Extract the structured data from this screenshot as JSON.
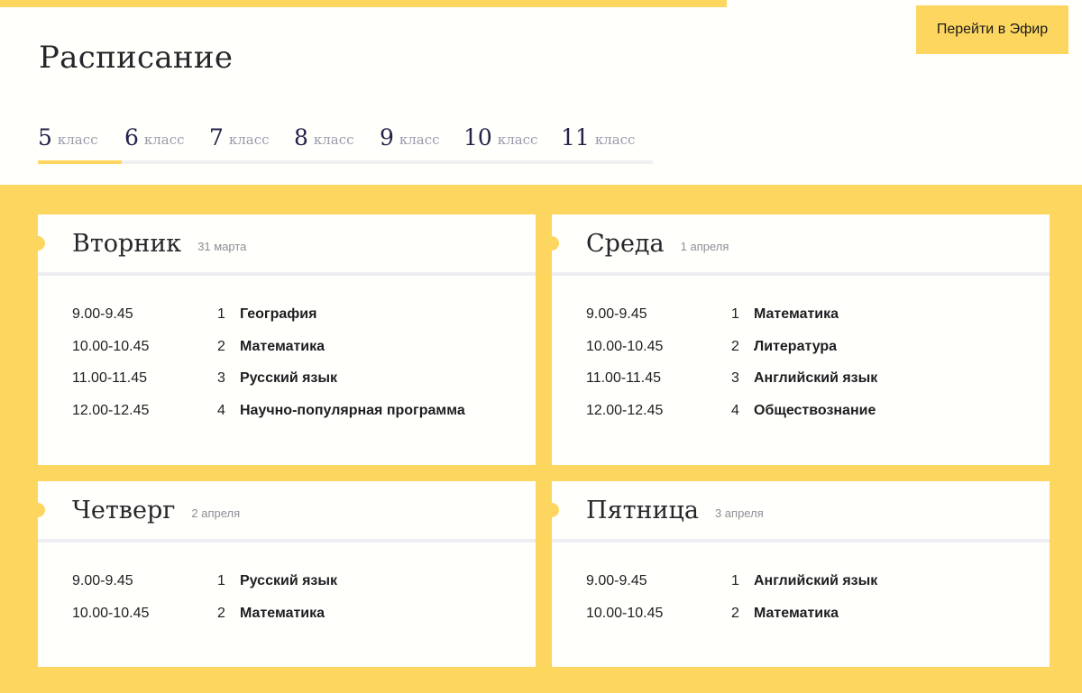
{
  "header": {
    "title": "Расписание",
    "live_button": "Перейти в Эфир"
  },
  "tabs": [
    {
      "num": "5",
      "word": "класс",
      "active": true
    },
    {
      "num": "6",
      "word": "класс"
    },
    {
      "num": "7",
      "word": "класс"
    },
    {
      "num": "8",
      "word": "класс"
    },
    {
      "num": "9",
      "word": "класс"
    },
    {
      "num": "10",
      "word": "класс"
    },
    {
      "num": "11",
      "word": "класс"
    }
  ],
  "days": [
    {
      "name": "Вторник",
      "date": "31 марта",
      "lessons": [
        {
          "time": "9.00-9.45",
          "num": "1",
          "subject": "География"
        },
        {
          "time": "10.00-10.45",
          "num": "2",
          "subject": "Математика"
        },
        {
          "time": "11.00-11.45",
          "num": "3",
          "subject": "Русский язык"
        },
        {
          "time": "12.00-12.45",
          "num": "4",
          "subject": "Научно-популярная программа"
        }
      ]
    },
    {
      "name": "Среда",
      "date": "1 апреля",
      "lessons": [
        {
          "time": "9.00-9.45",
          "num": "1",
          "subject": "Математика"
        },
        {
          "time": "10.00-10.45",
          "num": "2",
          "subject": "Литература"
        },
        {
          "time": "11.00-11.45",
          "num": "3",
          "subject": "Английский язык"
        },
        {
          "time": "12.00-12.45",
          "num": "4",
          "subject": "Обществознание"
        }
      ]
    },
    {
      "name": "Четверг",
      "date": "2 апреля",
      "lessons": [
        {
          "time": "9.00-9.45",
          "num": "1",
          "subject": "Русский язык"
        },
        {
          "time": "10.00-10.45",
          "num": "2",
          "subject": "Математика"
        }
      ]
    },
    {
      "name": "Пятница",
      "date": "3 апреля",
      "lessons": [
        {
          "time": "9.00-9.45",
          "num": "1",
          "subject": "Английский язык"
        },
        {
          "time": "10.00-10.45",
          "num": "2",
          "subject": "Математика"
        }
      ]
    }
  ],
  "colors": {
    "accent": "#fdd660",
    "background": "#fffffc",
    "text": "#26262b",
    "muted": "#8d8d96"
  }
}
